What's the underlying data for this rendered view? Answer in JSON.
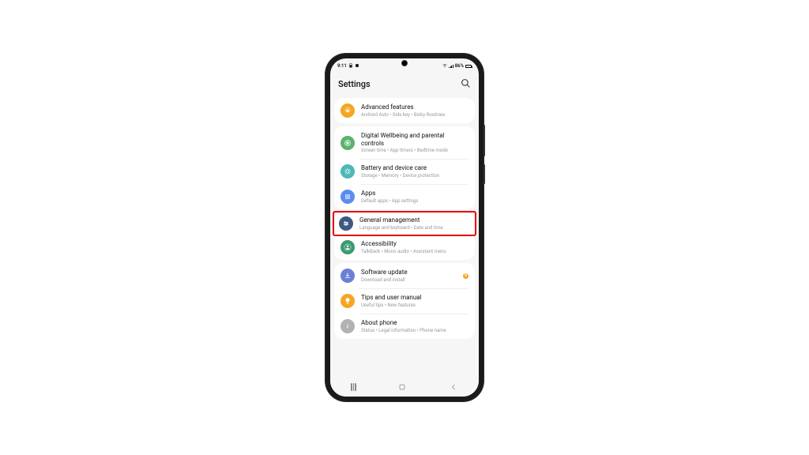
{
  "statusbar": {
    "time": "9:11",
    "battery": "86%"
  },
  "header": {
    "title": "Settings"
  },
  "groups": [
    {
      "items": [
        {
          "id": "advanced-features",
          "title": "Advanced features",
          "sub": "Android Auto  •  Side key  •  Bixby Routines",
          "color": "#f5a623",
          "icon": "gear"
        }
      ]
    },
    {
      "items": [
        {
          "id": "digital-wellbeing",
          "title": "Digital Wellbeing and parental controls",
          "sub": "Screen time  •  App timers  •  Bedtime mode",
          "color": "#59b36c",
          "icon": "wellbeing"
        },
        {
          "id": "battery-device-care",
          "title": "Battery and device care",
          "sub": "Storage  •  Memory  •  Device protection",
          "color": "#4db8b8",
          "icon": "care"
        },
        {
          "id": "apps",
          "title": "Apps",
          "sub": "Default apps  •  App settings",
          "color": "#5b8def",
          "icon": "apps"
        }
      ]
    },
    {
      "items": [
        {
          "id": "general-management",
          "title": "General management",
          "sub": "Language and keyboard  •  Date and time",
          "color": "#3d5a80",
          "icon": "sliders",
          "highlighted": true
        },
        {
          "id": "accessibility",
          "title": "Accessibility",
          "sub": "TalkBack  •  Mono audio  •  Assistant menu",
          "color": "#3a9b6e",
          "icon": "person-ring"
        }
      ]
    },
    {
      "items": [
        {
          "id": "software-update",
          "title": "Software update",
          "sub": "Download and install",
          "color": "#6b7fd7",
          "icon": "download",
          "badge": "N"
        },
        {
          "id": "tips-user-manual",
          "title": "Tips and user manual",
          "sub": "Useful tips  •  New features",
          "color": "#f5a623",
          "icon": "lightbulb"
        },
        {
          "id": "about-phone",
          "title": "About phone",
          "sub": "Status  •  Legal information  •  Phone name",
          "color": "#b2b2b2",
          "icon": "info"
        }
      ]
    }
  ],
  "nav_badge": "N"
}
